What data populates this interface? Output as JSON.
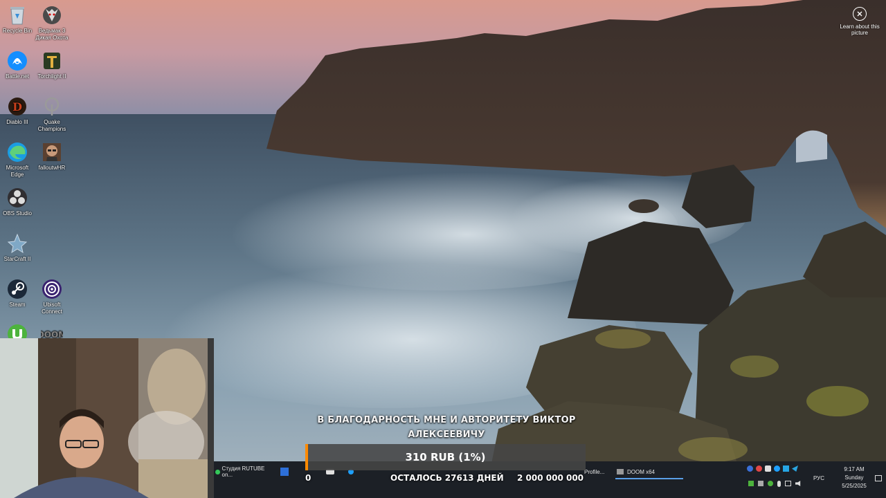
{
  "desktop": {
    "icons": [
      {
        "label": "Recycle Bin",
        "icon": "recycle-bin-icon"
      },
      {
        "label": "Ведьмак 3 Дикая Охота",
        "icon": "witcher-icon"
      },
      {
        "label": "Battle.net",
        "icon": "battlenet-icon"
      },
      {
        "label": "Torchlight II",
        "icon": "torchlight-icon"
      },
      {
        "label": "Diablo III",
        "icon": "diablo-icon"
      },
      {
        "label": "Quake Champions",
        "icon": "quake-icon"
      },
      {
        "label": "Microsoft Edge",
        "icon": "edge-icon"
      },
      {
        "label": "falloutwHR",
        "icon": "fallout-icon"
      },
      {
        "label": "OBS Studio",
        "icon": "obs-icon"
      },
      {
        "label": "StarCraft II",
        "icon": "starcraft-icon"
      },
      {
        "label": "Steam",
        "icon": "steam-icon"
      },
      {
        "label": "Ubisoft Connect",
        "icon": "ubisoft-icon"
      },
      {
        "label": "",
        "icon": "utorrent-icon"
      },
      {
        "label": "",
        "icon": "doom-icon"
      }
    ],
    "learn_label": "Learn about this picture"
  },
  "donation": {
    "message": "В БЛАГОДАРНОСТЬ МНЕ И АВТОРИТЕТУ ВИКТОР АЛЕКСЕЕВИЧУ",
    "amount": "310 RUB (1%)",
    "progress": 0.01,
    "start": "0",
    "remaining": "ОСТАЛОСЬ 27613 ДНЕЙ",
    "goal": "2 000 000 000"
  },
  "taskbar": {
    "items": [
      {
        "label": "Студия RUTUBE on...",
        "icon": "browser-icon"
      },
      {
        "label": "",
        "icon": "app-icon"
      },
      {
        "label": "",
        "icon": "app-icon"
      },
      {
        "label": "",
        "icon": "app-icon"
      },
      {
        "label": "Profile...",
        "icon": "app-icon"
      },
      {
        "label": "DOOM x64",
        "icon": "doom-icon"
      }
    ],
    "lang": "РУС",
    "time": "9:17 AM",
    "day": "Sunday",
    "date": "5/25/2025"
  },
  "colors": {
    "accent": "#ff8a00",
    "taskbar": "#1c2026"
  }
}
